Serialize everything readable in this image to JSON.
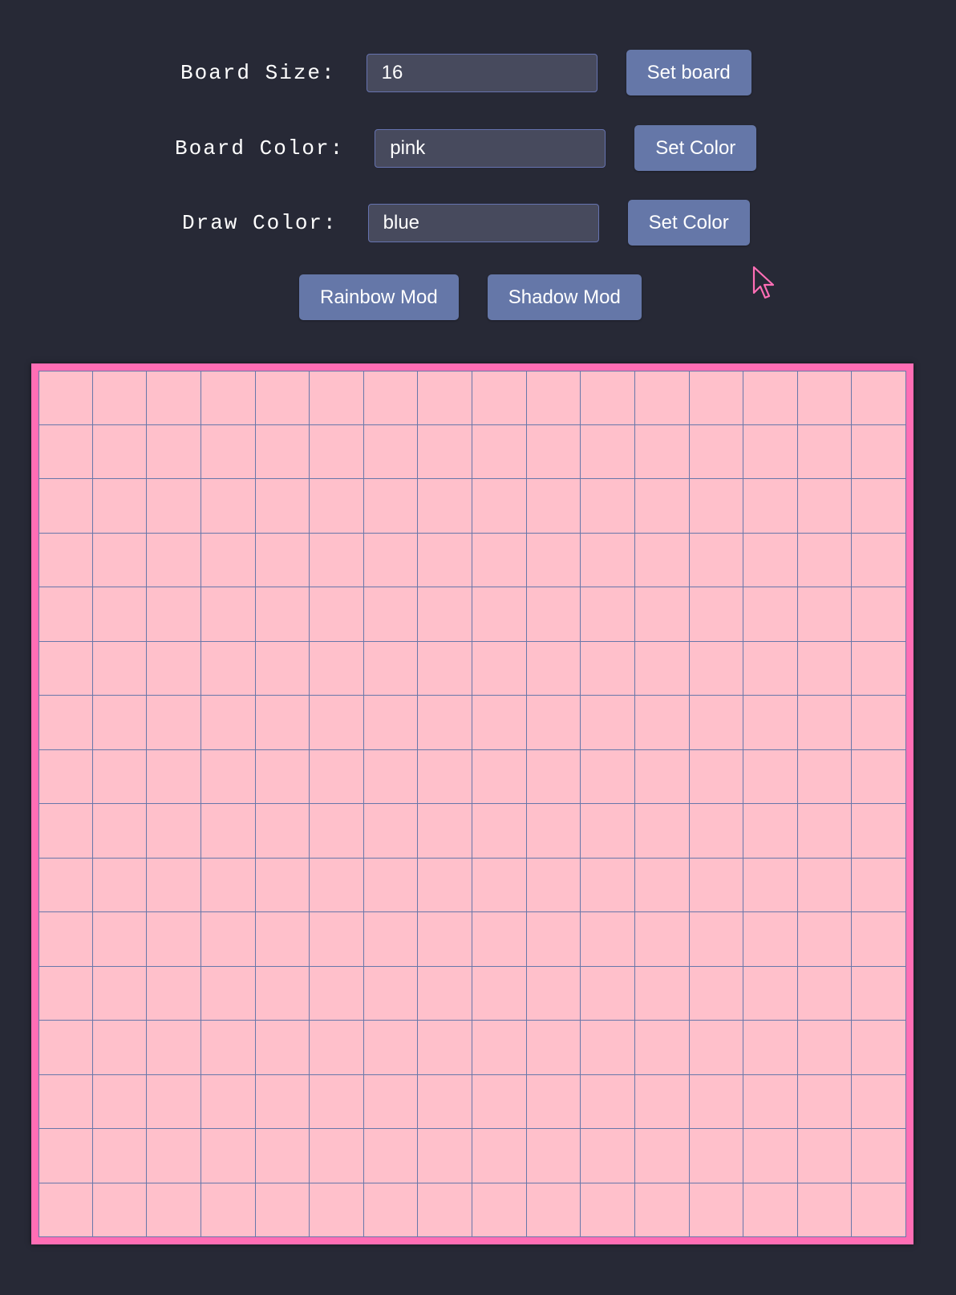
{
  "controls": {
    "board_size": {
      "label": "Board Size:",
      "value": "16",
      "button": "Set board"
    },
    "board_color": {
      "label": "Board Color:",
      "value": "pink",
      "button": "Set Color"
    },
    "draw_color": {
      "label": "Draw Color:",
      "value": "blue",
      "button": "Set Color"
    },
    "mods": {
      "rainbow": "Rainbow Mod",
      "shadow": "Shadow Mod"
    }
  },
  "board": {
    "rows": 16,
    "columns": 16,
    "cell_color": "#ffc0cb",
    "line_color": "#6877aa",
    "border_color": "#ff6eb5"
  },
  "colors": {
    "background": "#272936",
    "button": "#6577a8",
    "input": "#474a5d",
    "cursor": "#ff6eb5"
  },
  "icons": {
    "cursor": "mouse-pointer-icon"
  }
}
